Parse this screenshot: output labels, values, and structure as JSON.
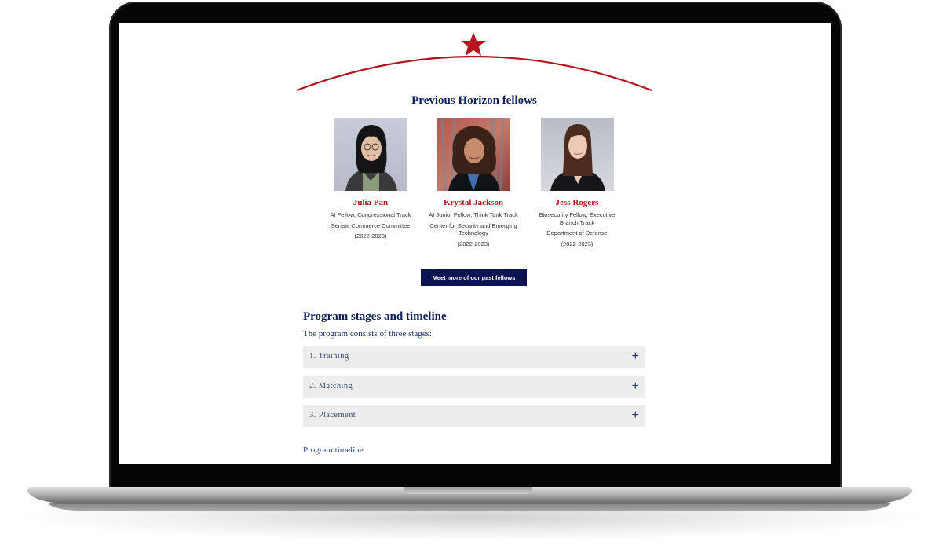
{
  "fellows_section": {
    "title": "Previous Horizon fellows",
    "fellows": [
      {
        "name": "Julia Pan",
        "role": "AI Fellow, Congressional Track",
        "org": "Senate Commerce Committee",
        "years": "(2022-2023)"
      },
      {
        "name": "Krystal Jackson",
        "role": "AI Junior Fellow, Think Tank Track",
        "org": "Center for Security and Emerging Technology",
        "years": "(2022-2023)"
      },
      {
        "name": "Jess Rogers",
        "role": "Biosecurity Fellow, Executive Branch Track",
        "org": "Department of Defense",
        "years": "(2022-2023)"
      }
    ],
    "cta_label": "Meet more of our past fellows"
  },
  "stages_section": {
    "title": "Program stages and timeline",
    "intro": "The program consists of three stages:",
    "stages": [
      {
        "label": "1. Training",
        "toggle": "+"
      },
      {
        "label": "2. Matching",
        "toggle": "+"
      },
      {
        "label": "3. Placement",
        "toggle": "+"
      }
    ],
    "timeline_label": "Program timeline"
  },
  "colors": {
    "accent_red": "#b3141d",
    "navy": "#0c1f5c",
    "button_bg": "#0b1450",
    "accordion_bg": "#ededed"
  }
}
